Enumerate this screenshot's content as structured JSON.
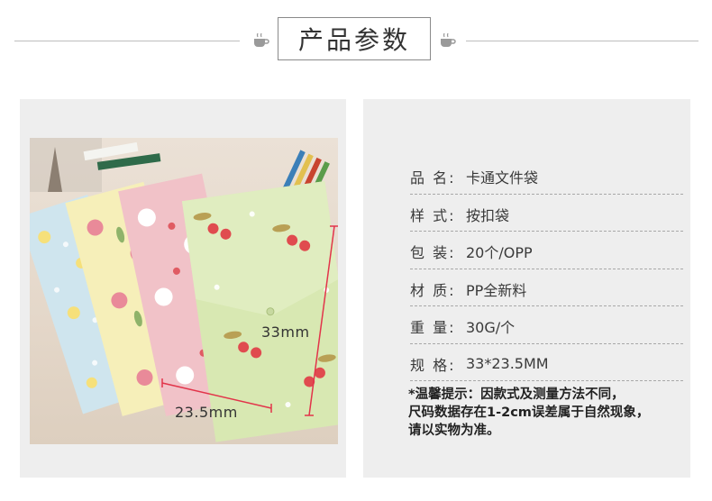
{
  "header": {
    "title": "产品参数",
    "cup_icon": "coffee-cup-icon"
  },
  "photo": {
    "height_label": "33mm",
    "width_label": "23.5mm",
    "colors": {
      "blue_folder": "#cfe5ee",
      "yellow_folder": "#f6efb9",
      "pink_folder": "#f1c2c8",
      "green_folder": "#d8e8b2",
      "dimension_line": "#e2344a"
    }
  },
  "specs": [
    {
      "key": "品 名:",
      "value": "卡通文件袋"
    },
    {
      "key": "样 式:",
      "value": "按扣袋"
    },
    {
      "key": "包 装:",
      "value": "20个/OPP"
    },
    {
      "key": "材 质:",
      "value": "PP全新料"
    },
    {
      "key": "重 量:",
      "value": "30G/个"
    },
    {
      "key": "规 格:",
      "value": "33*23.5MM"
    }
  ],
  "note": {
    "line1": "*温馨提示：因款式及测量方法不同，",
    "line2": "尺码数据存在1-2cm误差属于自然现象，",
    "line3": "请以实物为准。"
  }
}
